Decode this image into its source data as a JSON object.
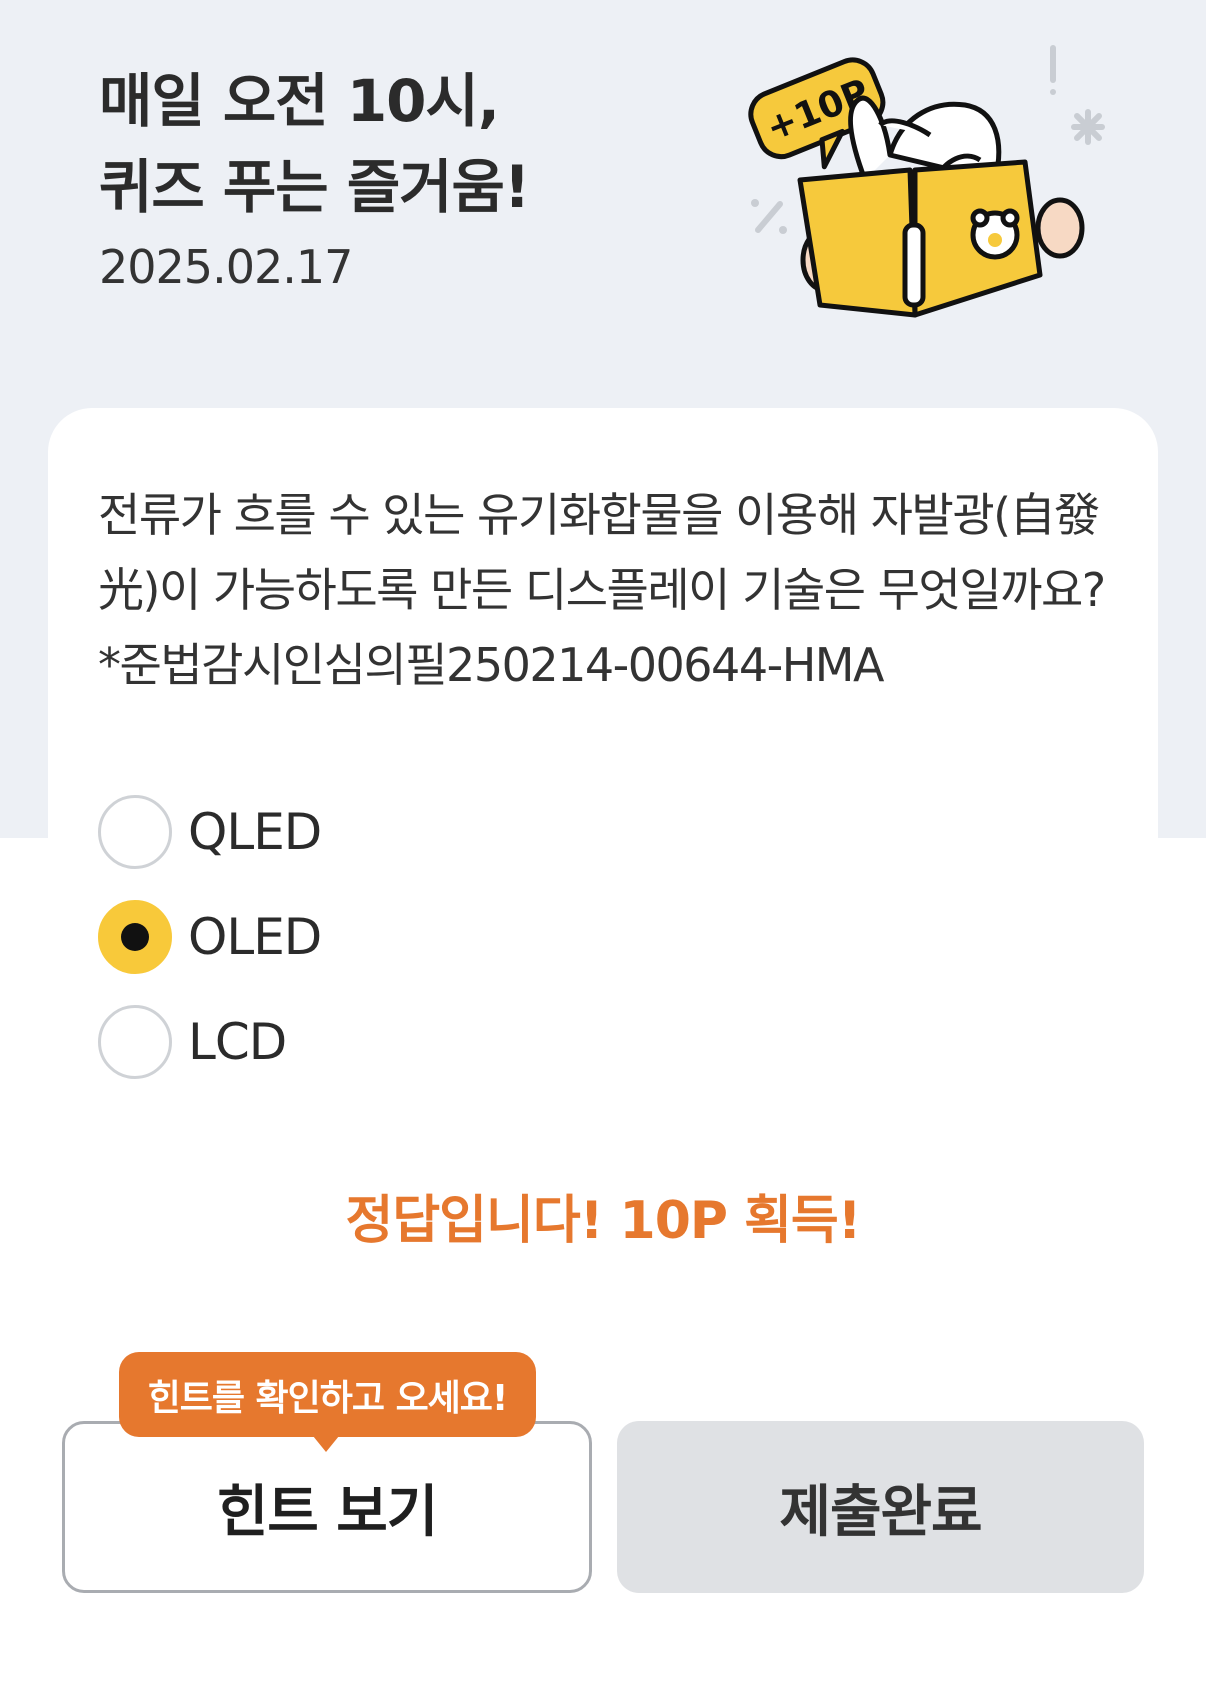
{
  "header": {
    "title_line1": "매일 오전 10시,",
    "title_line2": "퀴즈 푸는 즐거움!",
    "date": "2025.02.17",
    "badge": "+10P"
  },
  "quiz": {
    "question": "전류가 흐를 수 있는 유기화합물을 이용해 자발광(自發光)이 가능하도록 만든 디스플레이 기술은 무엇일까요? *준법감시인심의필250214-00644-HMA",
    "options": [
      {
        "label": "QLED",
        "selected": false
      },
      {
        "label": "OLED",
        "selected": true
      },
      {
        "label": "LCD",
        "selected": false
      }
    ],
    "result": "정답입니다! 10P 획득!"
  },
  "actions": {
    "hint_tooltip": "힌트를 확인하고 오세요!",
    "hint_label": "힌트 보기",
    "submit_label": "제출완료"
  },
  "colors": {
    "accent_orange": "#e6782e",
    "selected_yellow": "#f8c93a",
    "book_yellow": "#f6c93c",
    "band_background": "#edf0f5"
  }
}
